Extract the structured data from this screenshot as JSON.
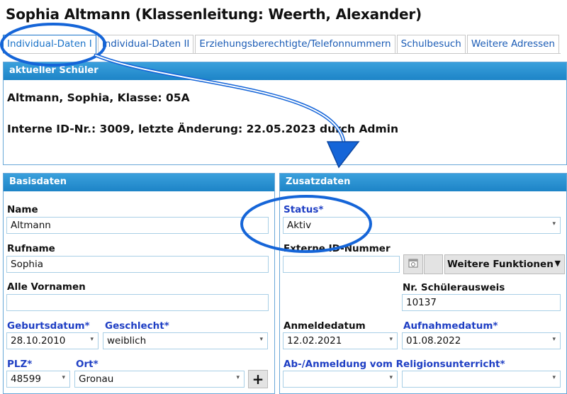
{
  "header": {
    "title": "Sophia Altmann (Klassenleitung: Weerth, Alexander)"
  },
  "tabs": [
    {
      "label": "Individual-Daten I"
    },
    {
      "label": "Individual-Daten II"
    },
    {
      "label": "Erziehungsberechtigte/Telefonnummern"
    },
    {
      "label": "Schulbesuch"
    },
    {
      "label": "Weitere Adressen"
    }
  ],
  "current": {
    "header": "aktueller Schüler",
    "line1": "Altmann, Sophia, Klasse: 05A",
    "line2": "Interne ID-Nr.: 3009, letzte Änderung: 22.05.2023 durch Admin"
  },
  "basis": {
    "header": "Basisdaten",
    "name_label": "Name",
    "name_value": "Altmann",
    "rufname_label": "Rufname",
    "rufname_value": "Sophia",
    "vornamen_label": "Alle Vornamen",
    "vornamen_value": "",
    "geburtsdatum_label": "Geburtsdatum*",
    "geburtsdatum_value": "28.10.2010",
    "geschlecht_label": "Geschlecht*",
    "geschlecht_value": "weiblich",
    "plz_label": "PLZ*",
    "plz_value": "48599",
    "ort_label": "Ort*",
    "ort_value": "Gronau",
    "add_label": "+"
  },
  "zusatz": {
    "header": "Zusatzdaten",
    "status_label": "Status*",
    "status_value": "Aktiv",
    "extid_label": "Externe ID-Nummer",
    "extid_value": "",
    "weitere_label": "Weitere Funktionen",
    "ausweis_label": "Nr. Schülerausweis",
    "ausweis_value": "10137",
    "anmelde_label": "Anmeldedatum",
    "anmelde_value": "12.02.2021",
    "aufnahme_label": "Aufnahmedatum*",
    "aufnahme_value": "01.08.2022",
    "religion_label": "Ab-/Anmeldung vom Religionsunterricht*"
  },
  "colors": {
    "accent": "#1d84c7",
    "required": "#1f3fc4",
    "annotation": "#1565d8"
  },
  "icons": {
    "calendar": "calendar-icon",
    "dropdown": "chevron-down-icon"
  }
}
